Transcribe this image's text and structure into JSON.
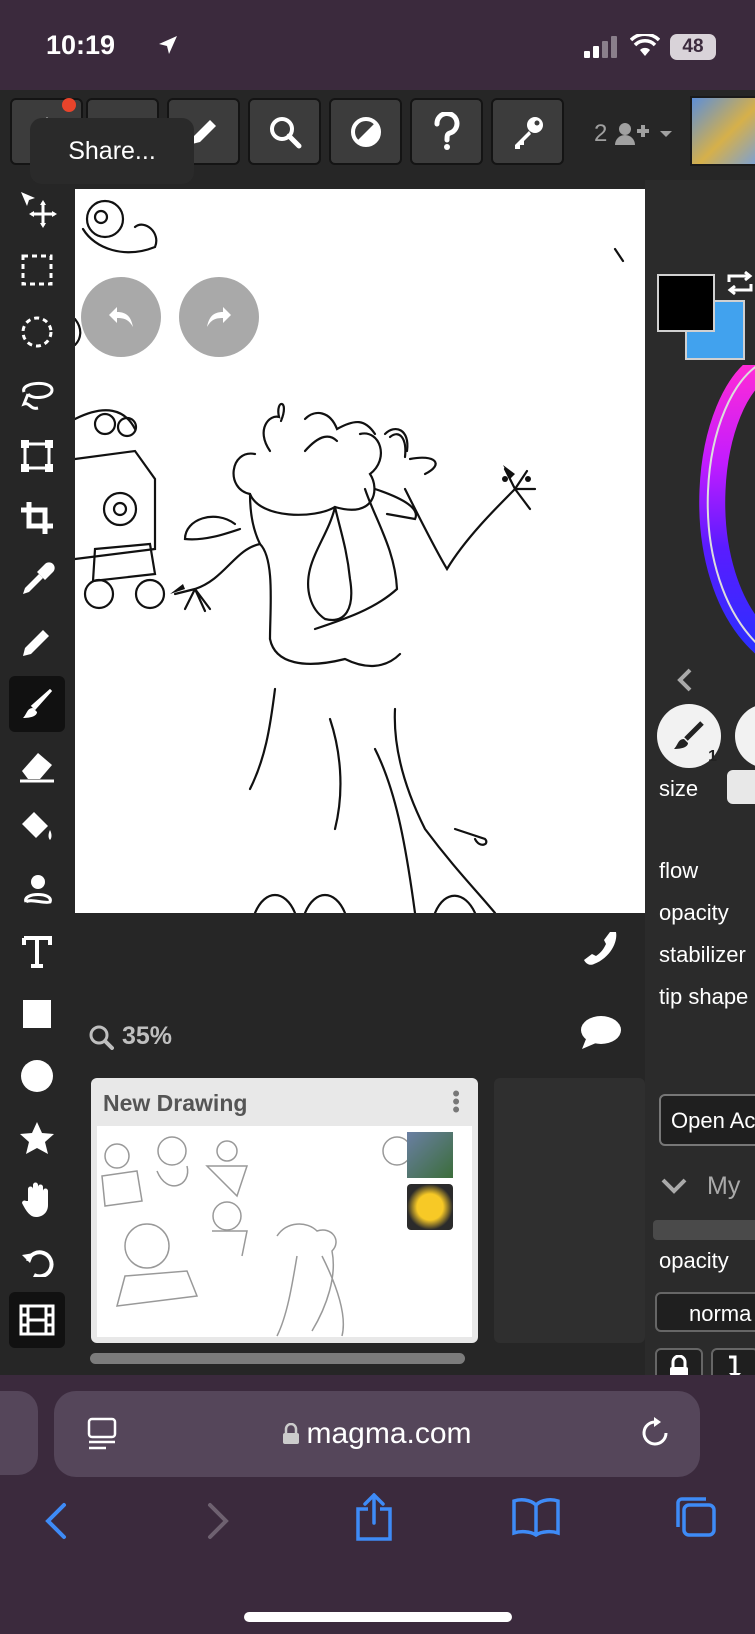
{
  "status_bar": {
    "time": "10:19",
    "battery": "48"
  },
  "toolbar": {
    "share_tooltip": "Share...",
    "users_count": "2"
  },
  "canvas": {
    "zoom": "35%"
  },
  "drawings": {
    "card_title": "New Drawing"
  },
  "right_panel": {
    "size_label": "size",
    "flow_label": "flow",
    "opacity_label": "opacity",
    "stabilizer_label": "stabilizer",
    "tip_shape_label": "tip shape",
    "open_button": "Open Ac",
    "layers_header": "My",
    "layer_opacity_label": "opacity",
    "blend_mode": "norma",
    "brush_number": "1"
  },
  "colors": {
    "primary": "#000000",
    "secondary": "#41a2ee",
    "accent_layer": "#e84aa0"
  },
  "browser": {
    "url": "magma.com"
  }
}
